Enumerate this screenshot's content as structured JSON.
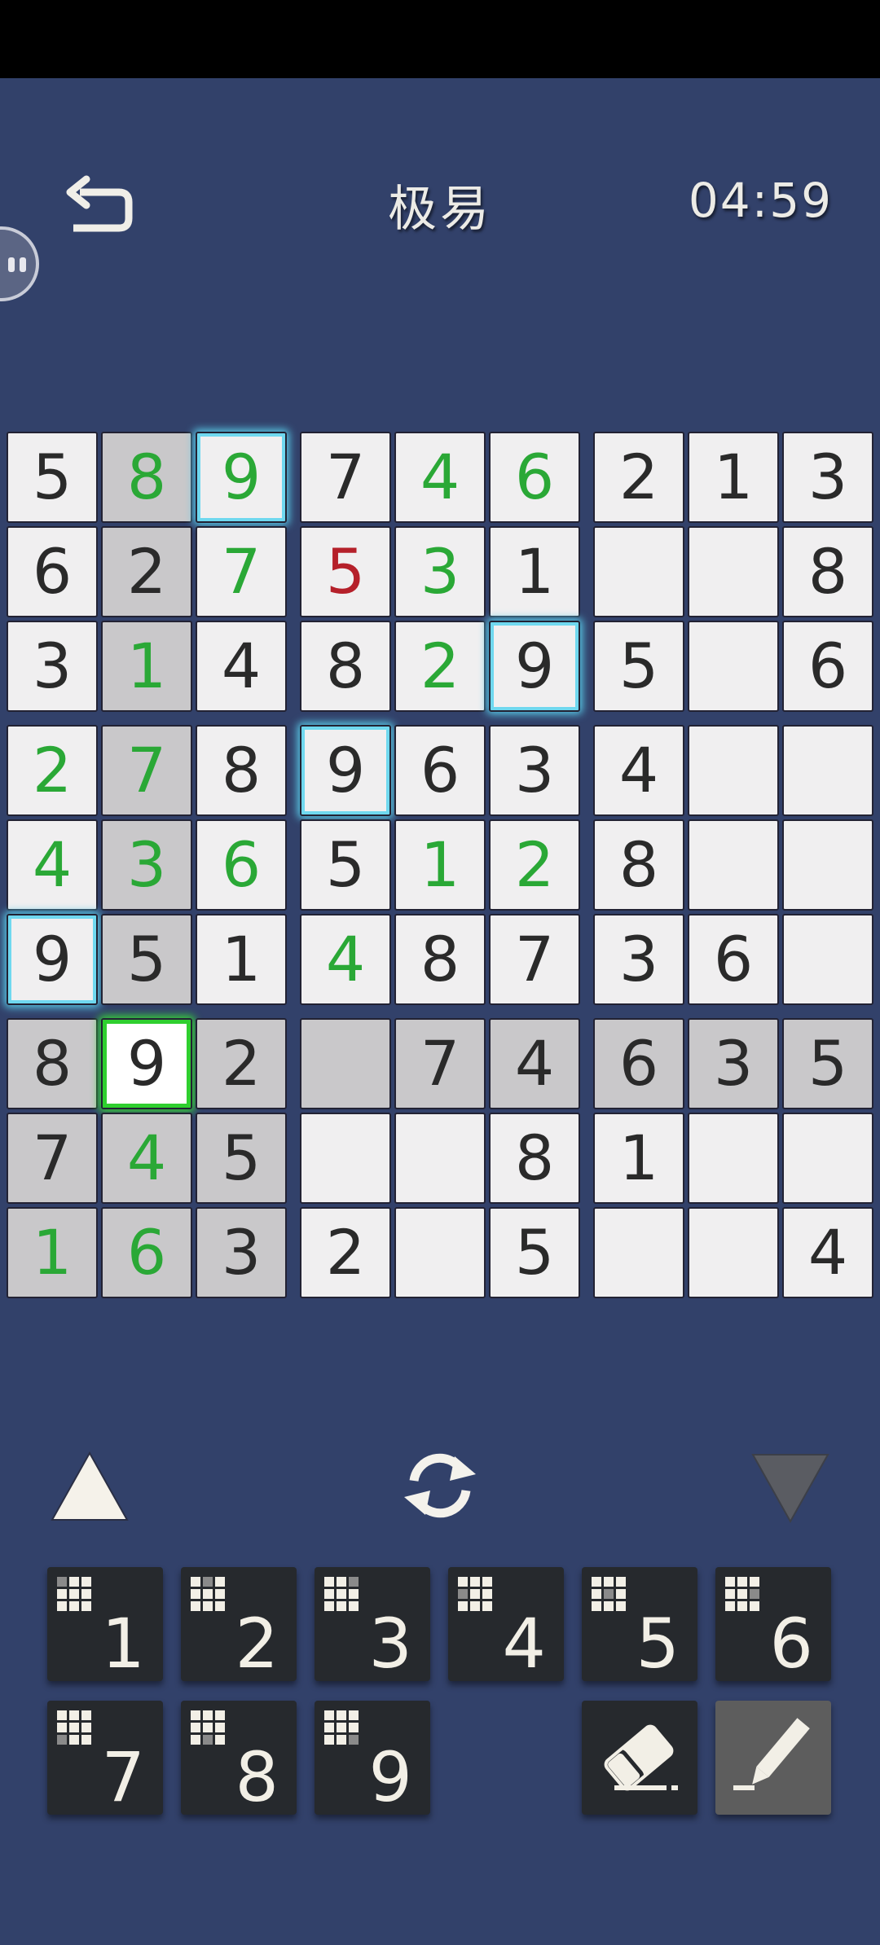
{
  "header": {
    "title": "极易",
    "timer": "04:59"
  },
  "board": {
    "rows": [
      [
        "5",
        "8",
        "9",
        "7",
        "4",
        "6",
        "2",
        "1",
        "3"
      ],
      [
        "6",
        "2",
        "7",
        "5",
        "3",
        "1",
        "",
        "",
        "8"
      ],
      [
        "3",
        "1",
        "4",
        "8",
        "2",
        "9",
        "5",
        "",
        "6"
      ],
      [
        "2",
        "7",
        "8",
        "9",
        "6",
        "3",
        "4",
        "",
        ""
      ],
      [
        "4",
        "3",
        "6",
        "5",
        "1",
        "2",
        "8",
        "",
        ""
      ],
      [
        "9",
        "5",
        "1",
        "4",
        "8",
        "7",
        "3",
        "6",
        ""
      ],
      [
        "8",
        "9",
        "2",
        "",
        "7",
        "4",
        "6",
        "3",
        "5"
      ],
      [
        "7",
        "4",
        "5",
        "",
        "",
        "8",
        "1",
        "",
        ""
      ],
      [
        "1",
        "6",
        "3",
        "2",
        "",
        "5",
        "",
        "",
        "4"
      ]
    ],
    "user_entered_color": "#2aa836",
    "error_color": "#b5202a",
    "given_color": "#2a2a2a",
    "highlight_color": "#c9c8ca",
    "glow_color": "#58c8e6",
    "selection_color": "#2fcf2f"
  },
  "controls": {
    "up_icon": "triangle-up-icon",
    "redo_icon": "refresh-icon",
    "down_icon": "triangle-down-icon"
  },
  "keypad": {
    "keys": [
      "1",
      "2",
      "3",
      "4",
      "5",
      "6",
      "7",
      "8",
      "9"
    ]
  },
  "tools": {
    "eraser_icon": "eraser-icon",
    "pencil_icon": "pencil-icon"
  }
}
